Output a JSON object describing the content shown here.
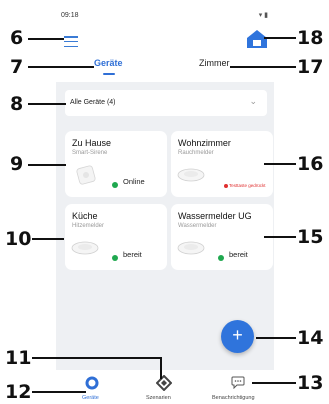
{
  "status_bar": {
    "time": "09:18",
    "icons": "▾ ▮"
  },
  "header": {
    "tabs": [
      {
        "label": "Geräte",
        "active": true
      },
      {
        "label": "Zimmer",
        "active": false
      }
    ]
  },
  "filter": {
    "selected": "Alle Geräte (4)"
  },
  "devices": [
    {
      "name": "Zu Hause",
      "type": "Smart-Sirene",
      "status": "Online"
    },
    {
      "name": "Wohnzimmer",
      "type": "Rauchmelder",
      "status": "Testtaste gedrückt"
    },
    {
      "name": "Küche",
      "type": "Hitzemelder",
      "status": "bereit"
    },
    {
      "name": "Wassermelder UG",
      "type": "Wassermelder",
      "status": "bereit"
    }
  ],
  "bottom_nav": [
    {
      "label": "Geräte",
      "icon": "devices-ring-icon",
      "active": true
    },
    {
      "label": "Szenarien",
      "icon": "scenarios-icon",
      "active": false
    },
    {
      "label": "Benachrichtigung",
      "icon": "notification-bubble-icon",
      "active": false
    }
  ],
  "callouts": [
    "6",
    "7",
    "8",
    "9",
    "10",
    "11",
    "12",
    "13",
    "14",
    "15",
    "16",
    "17",
    "18"
  ],
  "colors": {
    "accent": "#2f6fd6",
    "status_ok": "#1fa84f",
    "status_warn": "#e03030",
    "background": "#eef0f3"
  }
}
